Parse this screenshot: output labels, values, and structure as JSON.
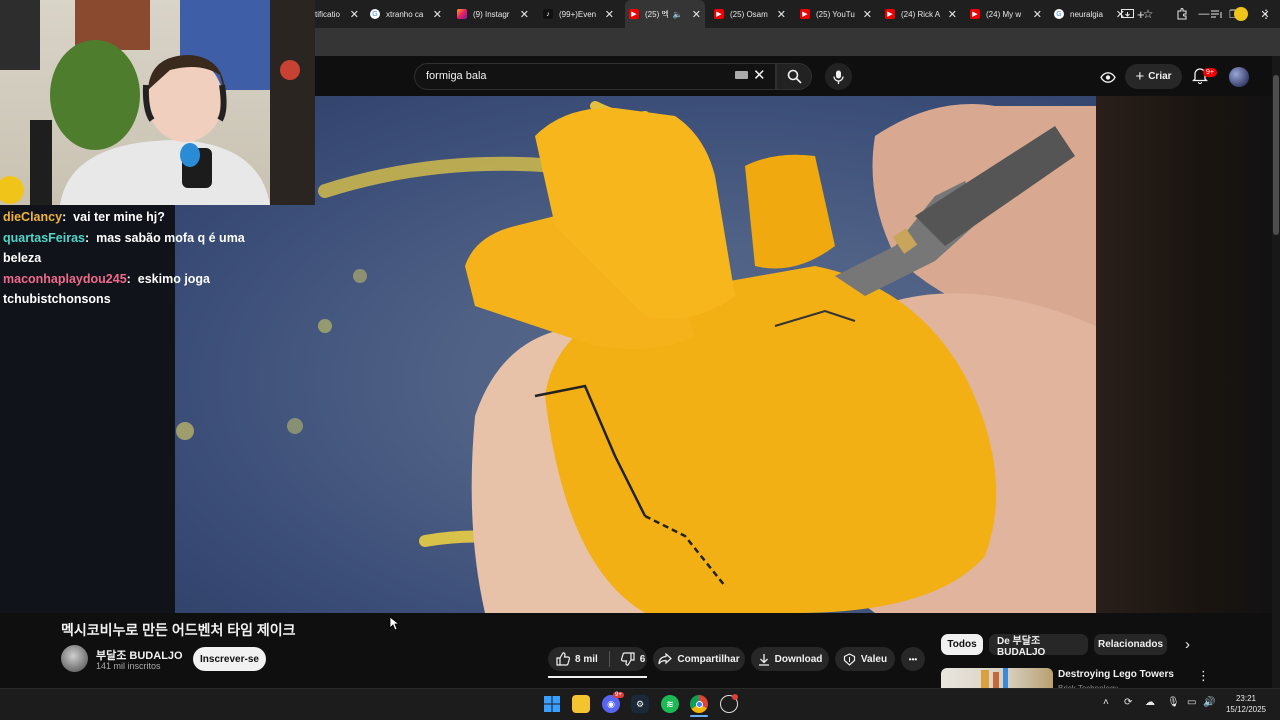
{
  "browser": {
    "tabs": [
      {
        "label": "tificatio",
        "favicon": "generic-icon"
      },
      {
        "label": "xtranho ca",
        "favicon": "google-icon"
      },
      {
        "label": "(9) Instagr",
        "favicon": "instagram-icon"
      },
      {
        "label": "(99+)Even",
        "favicon": "tiktok-icon"
      },
      {
        "label": "(25) 멕",
        "favicon": "youtube-icon",
        "active": true
      },
      {
        "label": "(25) Osam",
        "favicon": "youtube-icon"
      },
      {
        "label": "(25) YouTu",
        "favicon": "youtube-icon"
      },
      {
        "label": "(24) Rick A",
        "favicon": "youtube-icon"
      },
      {
        "label": "(24) My w",
        "favicon": "youtube-icon"
      },
      {
        "label": "neuralgia",
        "favicon": "google-icon"
      }
    ],
    "new_tab": "+",
    "window_controls": {
      "minimize": "—",
      "maximize": "❐",
      "close": "✕"
    }
  },
  "youtube": {
    "search": {
      "query": "formiga bala"
    },
    "create_label": "Criar",
    "notifications_badge": "9+"
  },
  "stream": {
    "chat": [
      {
        "user": "dieClancy",
        "color": "#f0b43c",
        "message": "vai ter mine hj?"
      },
      {
        "user": "quartasFeiras",
        "color": "#4fd6c8",
        "message": "mas sabão mofa q é uma beleza"
      },
      {
        "user": "maconhaplaydou245",
        "color": "#f06a8c",
        "message": "eskimo joga tchubistchonsons"
      }
    ]
  },
  "video": {
    "title": "멕시코비누로 만든 어드벤처 타임 제이크",
    "channel": {
      "name": "부달조 BUDALJO",
      "subscribers": "141 mil inscritos"
    },
    "subscribe_label": "Inscrever-se",
    "likes": "8 mil",
    "dislikes": "6",
    "share_label": "Compartilhar",
    "download_label": "Download",
    "thanks_label": "Valeu",
    "more_label": "•••"
  },
  "sidebar": {
    "chips": [
      "Todos",
      "De 부달조 BUDALJO",
      "Relacionados"
    ],
    "recommendation": {
      "title": "Destroying Lego Towers",
      "channel": "Brick Technology"
    }
  },
  "taskbar": {
    "time": "23:21",
    "date": "15/12/2025",
    "discord_badge": "9+"
  }
}
